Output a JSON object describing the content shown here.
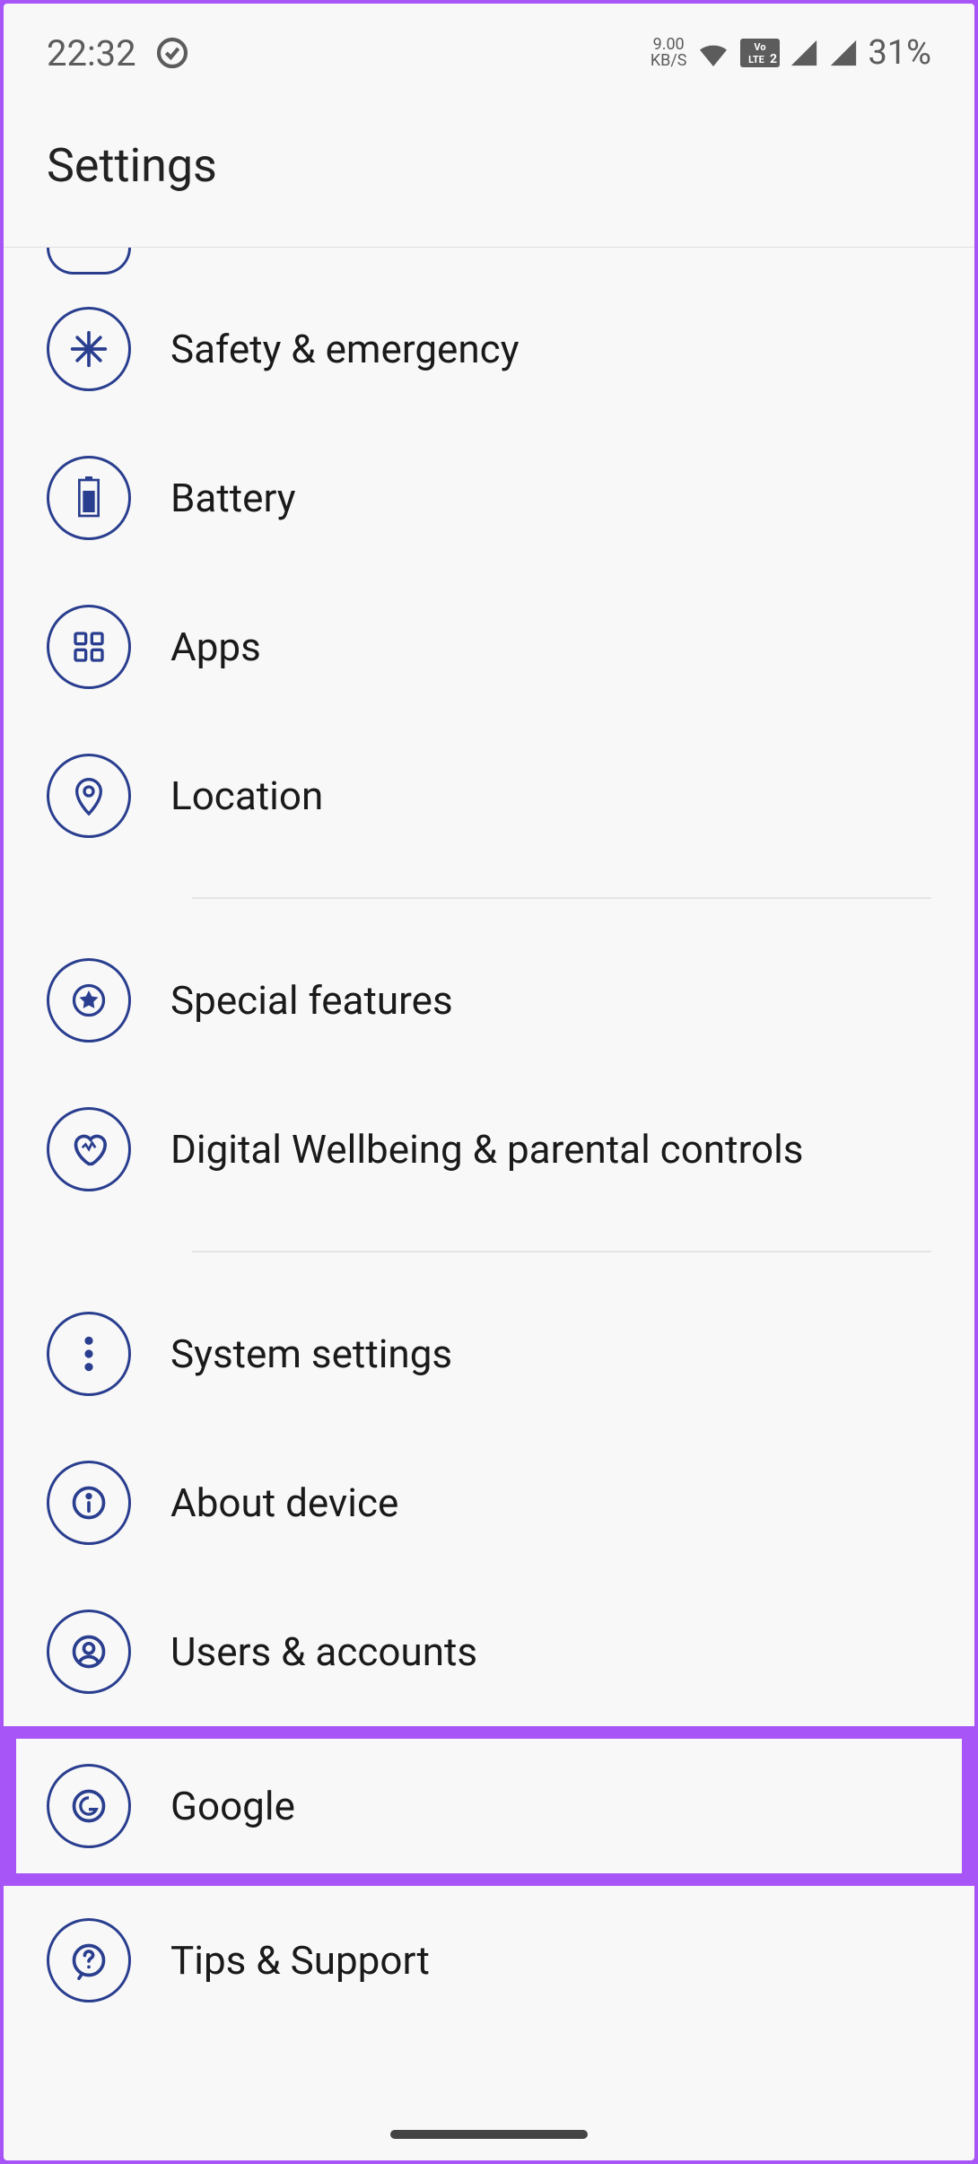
{
  "status_bar": {
    "time": "22:32",
    "data_speed": "9.00",
    "data_unit": "KB/S",
    "volte": "VoLTE 2",
    "battery_percent": "31%"
  },
  "header": {
    "title": "Settings"
  },
  "items": [
    {
      "label": "Safety & emergency",
      "icon": "medical"
    },
    {
      "label": "Battery",
      "icon": "battery"
    },
    {
      "label": "Apps",
      "icon": "apps"
    },
    {
      "label": "Location",
      "icon": "location"
    },
    {
      "label": "Special features",
      "icon": "star-circle"
    },
    {
      "label": "Digital Wellbeing & parental controls",
      "icon": "heart"
    },
    {
      "label": "System settings",
      "icon": "dots"
    },
    {
      "label": "About device",
      "icon": "info"
    },
    {
      "label": "Users & accounts",
      "icon": "user"
    },
    {
      "label": "Google",
      "icon": "google"
    },
    {
      "label": "Tips & Support",
      "icon": "help"
    }
  ],
  "colors": {
    "accent": "#2a3e8f",
    "highlight": "#a855f7"
  }
}
